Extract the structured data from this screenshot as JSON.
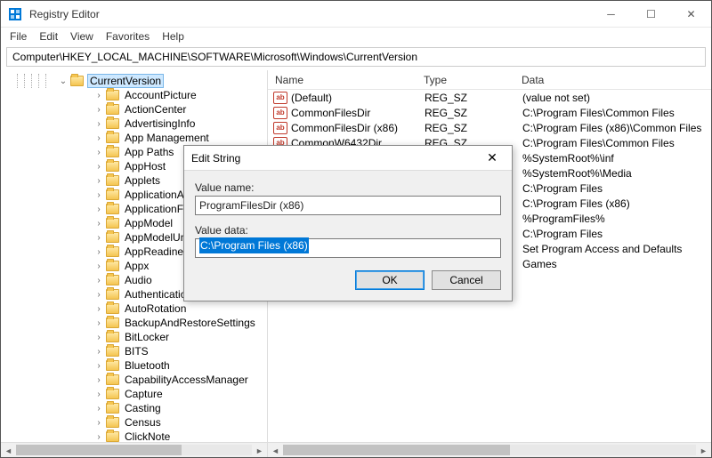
{
  "window": {
    "title": "Registry Editor"
  },
  "menu": [
    "File",
    "Edit",
    "View",
    "Favorites",
    "Help"
  ],
  "address": "Computer\\HKEY_LOCAL_MACHINE\\SOFTWARE\\Microsoft\\Windows\\CurrentVersion",
  "tree": {
    "selected": "CurrentVersion",
    "children": [
      "AccountPicture",
      "ActionCenter",
      "AdvertisingInfo",
      "App Management",
      "App Paths",
      "AppHost",
      "Applets",
      "ApplicationAssociationToasts",
      "ApplicationFrame",
      "AppModel",
      "AppModelUnlock",
      "AppReadiness",
      "Appx",
      "Audio",
      "Authentication",
      "AutoRotation",
      "BackupAndRestoreSettings",
      "BitLocker",
      "BITS",
      "Bluetooth",
      "CapabilityAccessManager",
      "Capture",
      "Casting",
      "Census",
      "ClickNote"
    ]
  },
  "columns": {
    "name": "Name",
    "type": "Type",
    "data": "Data"
  },
  "values": [
    {
      "name": "(Default)",
      "type": "REG_SZ",
      "data": "(value not set)"
    },
    {
      "name": "CommonFilesDir",
      "type": "REG_SZ",
      "data": "C:\\Program Files\\Common Files"
    },
    {
      "name": "CommonFilesDir (x86)",
      "type": "REG_SZ",
      "data": "C:\\Program Files (x86)\\Common Files"
    },
    {
      "name": "CommonW6432Dir",
      "type": "REG_SZ",
      "data": "C:\\Program Files\\Common Files"
    },
    {
      "name": "",
      "type": "",
      "data": "%SystemRoot%\\inf"
    },
    {
      "name": "",
      "type": "",
      "data": "%SystemRoot%\\Media"
    },
    {
      "name": "",
      "type": "",
      "data": "C:\\Program Files"
    },
    {
      "name": "",
      "type": "",
      "data": "C:\\Program Files (x86)"
    },
    {
      "name": "",
      "type": "",
      "data": "%ProgramFiles%"
    },
    {
      "name": "",
      "type": "",
      "data": "C:\\Program Files"
    },
    {
      "name": "",
      "type": "",
      "data": "Set Program Access and Defaults"
    },
    {
      "name": "",
      "type": "",
      "data": "Games"
    }
  ],
  "dialog": {
    "title": "Edit String",
    "value_name_label": "Value name:",
    "value_name": "ProgramFilesDir (x86)",
    "value_data_label": "Value data:",
    "value_data": "C:\\Program Files (x86)",
    "ok": "OK",
    "cancel": "Cancel"
  }
}
